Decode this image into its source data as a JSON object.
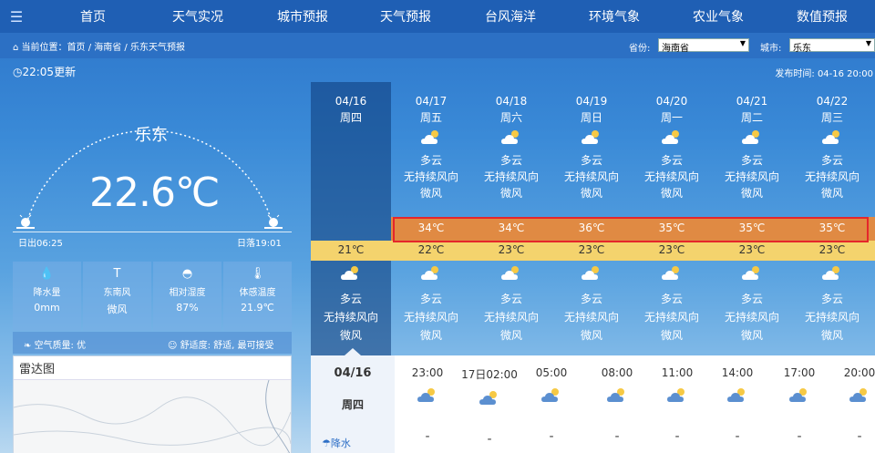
{
  "nav": {
    "menu_icon": "menu-icon",
    "items": [
      "首页",
      "天气实况",
      "城市预报",
      "天气预报",
      "台风海洋",
      "环境气象",
      "农业气象",
      "数值预报"
    ]
  },
  "breadcrumb": {
    "text": "当前位置：首页 / 海南省 / 乐东天气预报"
  },
  "selectors": {
    "province_label": "省份:",
    "province_value": "海南省",
    "city_label": "城市:",
    "city_value": "乐东"
  },
  "update": {
    "text": "22:05更新",
    "publish": "发布时间: 04-16 20:00"
  },
  "current": {
    "city": "乐东",
    "temperature": "22.6℃",
    "sunrise": "日出06:25",
    "sunset": "日落19:01"
  },
  "stats": [
    {
      "icon": "water-drop-icon",
      "label": "降水量",
      "value": "0mm"
    },
    {
      "icon": "wind-icon",
      "label": "东南风",
      "value": "微风"
    },
    {
      "icon": "humidity-icon",
      "label": "相对湿度",
      "value": "87%"
    },
    {
      "icon": "thermometer-icon",
      "label": "体感温度",
      "value": "21.9℃"
    }
  ],
  "air": {
    "quality": "空气质量: 优",
    "comfort": "舒适度: 舒适, 最可接受"
  },
  "radar": {
    "title": "雷达图"
  },
  "forecast": [
    {
      "date": "04/16",
      "weekday": "周四",
      "weather": "",
      "wind_dir": "",
      "wind_level": "",
      "high": "",
      "low": "21℃",
      "night_weather": "多云",
      "night_wind_dir": "无持续风向",
      "night_wind_level": "微风"
    },
    {
      "date": "04/17",
      "weekday": "周五",
      "weather": "多云",
      "wind_dir": "无持续风向",
      "wind_level": "微风",
      "high": "34℃",
      "low": "22℃",
      "night_weather": "多云",
      "night_wind_dir": "无持续风向",
      "night_wind_level": "微风"
    },
    {
      "date": "04/18",
      "weekday": "周六",
      "weather": "多云",
      "wind_dir": "无持续风向",
      "wind_level": "微风",
      "high": "34℃",
      "low": "23℃",
      "night_weather": "多云",
      "night_wind_dir": "无持续风向",
      "night_wind_level": "微风"
    },
    {
      "date": "04/19",
      "weekday": "周日",
      "weather": "多云",
      "wind_dir": "无持续风向",
      "wind_level": "微风",
      "high": "36℃",
      "low": "23℃",
      "night_weather": "多云",
      "night_wind_dir": "无持续风向",
      "night_wind_level": "微风"
    },
    {
      "date": "04/20",
      "weekday": "周一",
      "weather": "多云",
      "wind_dir": "无持续风向",
      "wind_level": "微风",
      "high": "35℃",
      "low": "23℃",
      "night_weather": "多云",
      "night_wind_dir": "无持续风向",
      "night_wind_level": "微风"
    },
    {
      "date": "04/21",
      "weekday": "周二",
      "weather": "多云",
      "wind_dir": "无持续风向",
      "wind_level": "微风",
      "high": "35℃",
      "low": "23℃",
      "night_weather": "多云",
      "night_wind_dir": "无持续风向",
      "night_wind_level": "微风"
    },
    {
      "date": "04/22",
      "weekday": "周三",
      "weather": "多云",
      "wind_dir": "无持续风向",
      "wind_level": "微风",
      "high": "35℃",
      "low": "23℃",
      "night_weather": "多云",
      "night_wind_dir": "无持续风向",
      "night_wind_level": "微风"
    }
  ],
  "hourly": {
    "day_date": "04/16",
    "day_weekday": "周四",
    "rain_label": "降水",
    "times": [
      "23:00",
      "17日02:00",
      "05:00",
      "08:00",
      "11:00",
      "14:00",
      "17:00",
      "20:00"
    ]
  },
  "colors": {
    "nav": "#1f5fb4",
    "high_band": "#e08a43",
    "low_band": "#f4d36d",
    "highlight": "#e5262b"
  }
}
